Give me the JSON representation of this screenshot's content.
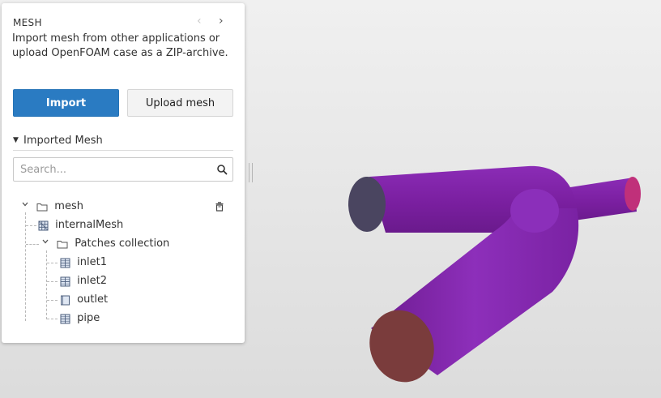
{
  "panel": {
    "title": "MESH",
    "description": "Import mesh from other applications or upload OpenFOAM case as a ZIP-archive.",
    "nav_prev": "‹",
    "nav_next": "›",
    "import_label": "Import",
    "upload_label": "Upload mesh",
    "section_label": "Imported Mesh",
    "search_placeholder": "Search..."
  },
  "tree": {
    "root": "mesh",
    "internal": "internalMesh",
    "patches_group": "Patches collection",
    "patches": [
      {
        "name": "inlet1",
        "icon": "patch-grid-icon"
      },
      {
        "name": "inlet2",
        "icon": "patch-grid-icon"
      },
      {
        "name": "outlet",
        "icon": "patch-plain-icon"
      },
      {
        "name": "pipe",
        "icon": "patch-grid-icon"
      }
    ]
  },
  "colors": {
    "accent": "#2a7bc2",
    "pipe": "#7a1fa0",
    "pipe_light": "#9233bd",
    "inlet_cap": "#4a4560",
    "outlet_cap": "#c0307a",
    "bottom_cap": "#7a3c3c"
  }
}
